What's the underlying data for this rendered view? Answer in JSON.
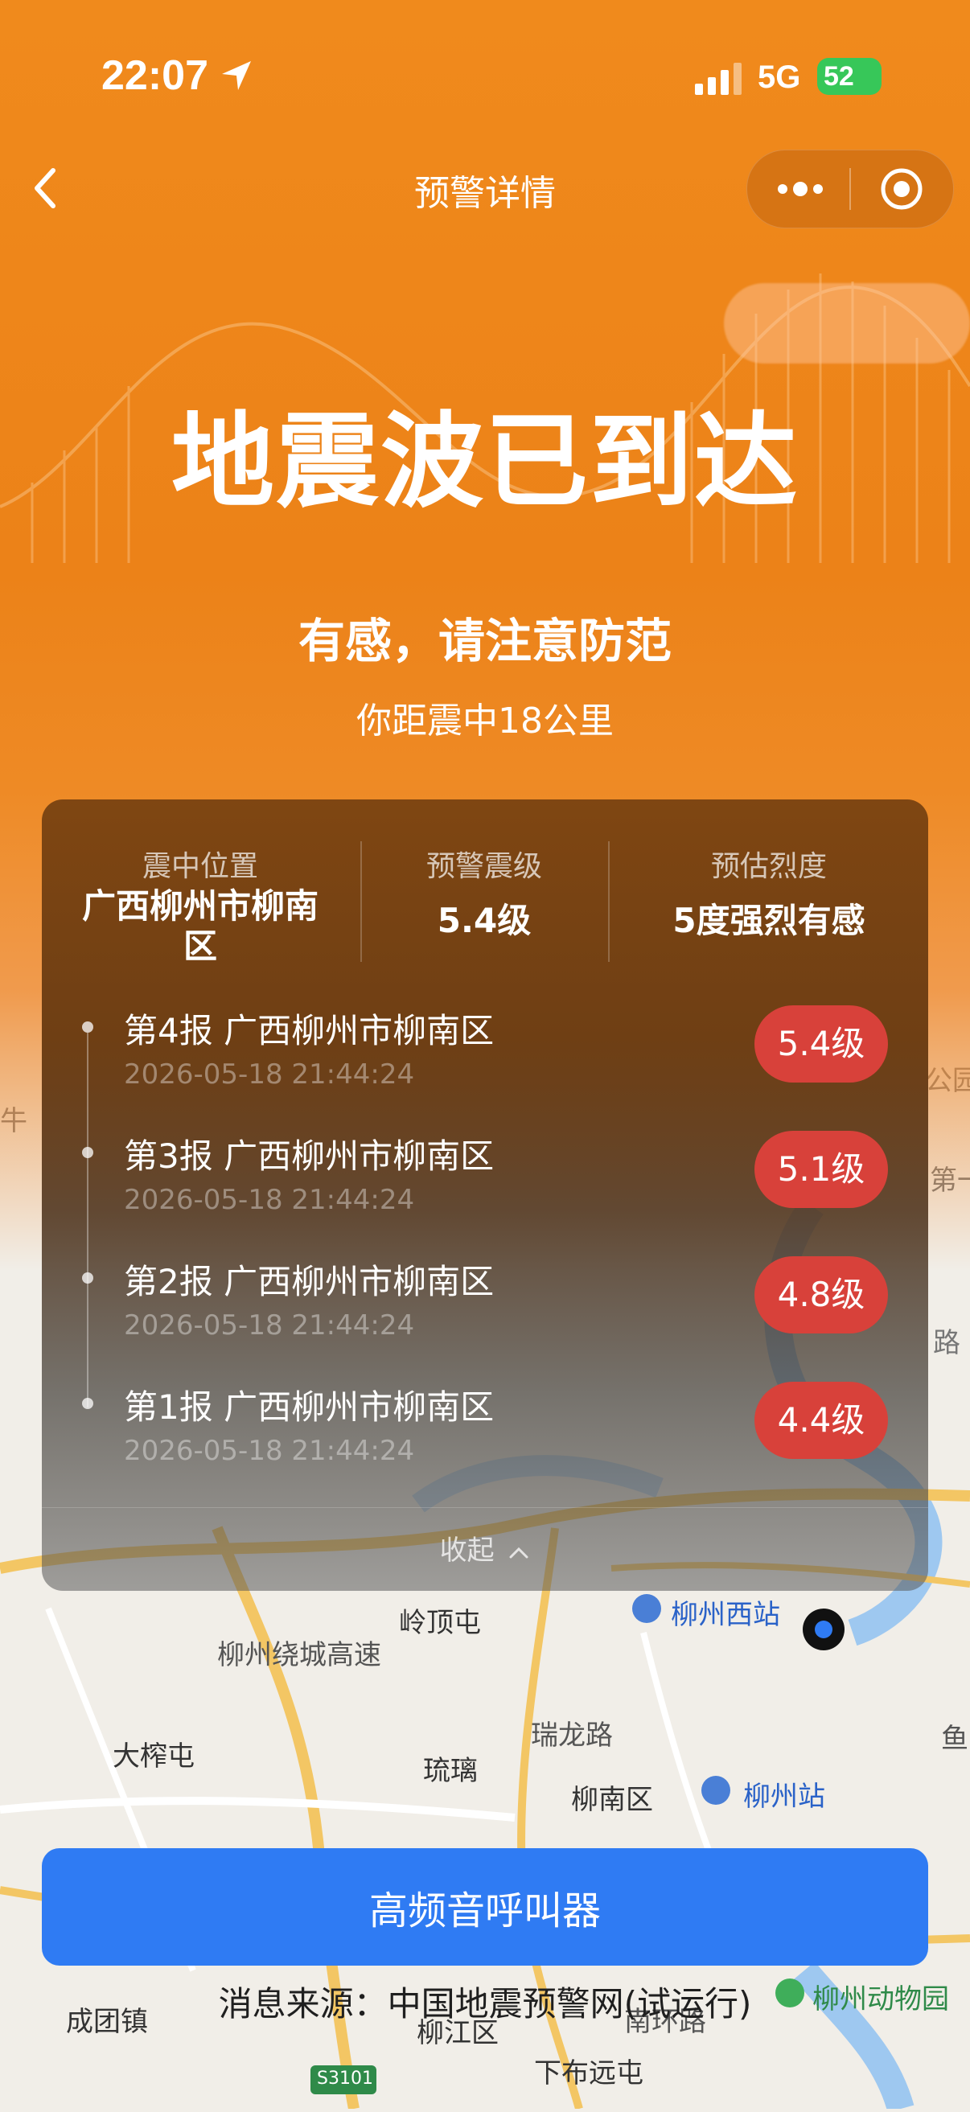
{
  "status_bar": {
    "time": "22:07",
    "network": "5G",
    "battery": "52"
  },
  "nav": {
    "title": "预警详情",
    "back_icon": "chevron-left-icon",
    "more_icon": "more-dots-icon",
    "close_icon": "target-circle-icon"
  },
  "hero": {
    "headline": "地震波已到达",
    "subtitle": "有感，请注意防范",
    "distance": "你距震中18公里"
  },
  "summary": {
    "location_label": "震中位置",
    "location_value": "广西柳州市柳南区",
    "magnitude_label": "预警震级",
    "magnitude_value": "5.4级",
    "intensity_label": "预估烈度",
    "intensity_value": "5度强烈有感"
  },
  "reports": [
    {
      "title": "第4报  广西柳州市柳南区",
      "time": "2026-05-18 21:44:24",
      "magnitude": "5.4级"
    },
    {
      "title": "第3报  广西柳州市柳南区",
      "time": "2026-05-18 21:44:24",
      "magnitude": "5.1级"
    },
    {
      "title": "第2报  广西柳州市柳南区",
      "time": "2026-05-18 21:44:24",
      "magnitude": "4.8级"
    },
    {
      "title": "第1报  广西柳州市柳南区",
      "time": "2026-05-18 21:44:24",
      "magnitude": "4.4级"
    }
  ],
  "collapse_label": "收起",
  "map_labels": {
    "lingdingtun": "岭顶屯",
    "liuzhou_west": "柳州西站",
    "ruilong_road": "瑞龙路",
    "ring_highway": "柳州绕城高速",
    "dazhatun": "大榨屯",
    "liuli": "琉璃",
    "liunan_district": "柳南区",
    "liuzhou_station": "柳州站",
    "chengtuan": "成团镇",
    "liujiang": "柳江区",
    "nanhuan_road": "南环路",
    "zoo": "柳州动物园",
    "xiabuyuantun": "下布远屯",
    "s3101": "S3101",
    "park": "公园",
    "niu": "牛",
    "di": "第一",
    "lu": "路",
    "yu": "鱼"
  },
  "pager_button": "高频音呼叫器",
  "source": "消息来源：中国地震预警网(试运行)",
  "colors": {
    "orange": "#ec8218",
    "badge_red": "#d8413a",
    "button_blue": "#2f7bf3"
  }
}
